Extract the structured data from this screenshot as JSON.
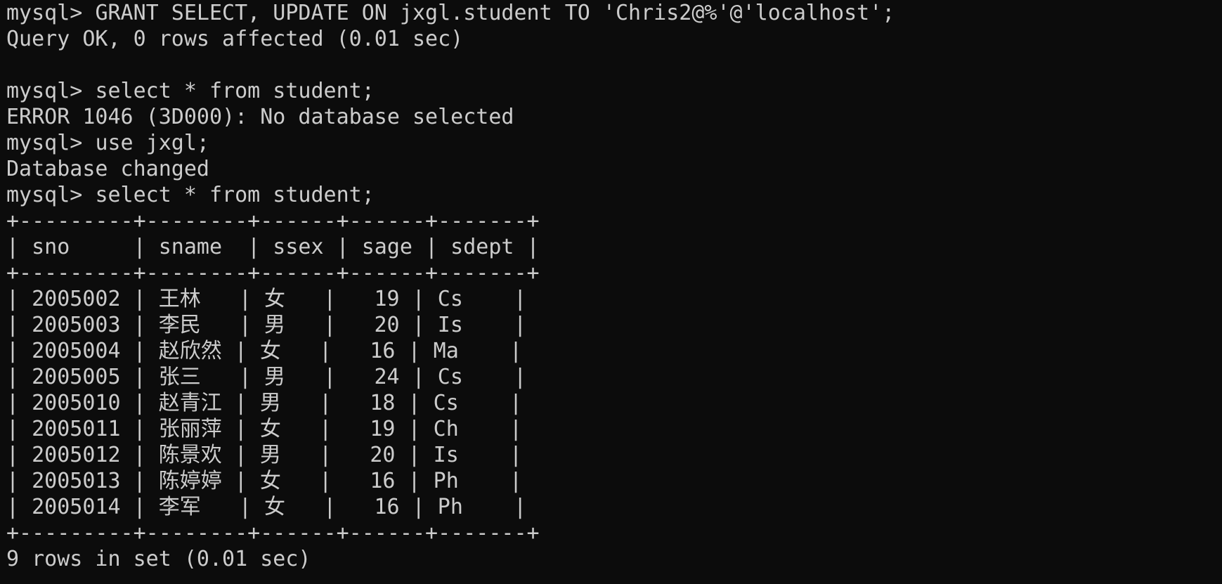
{
  "terminal": {
    "lines": [
      {
        "kind": "command",
        "prompt": "mysql>",
        "text": "GRANT SELECT, UPDATE ON jxgl.student TO 'Chris2@%'@'localhost';"
      },
      {
        "kind": "output",
        "text": "Query OK, 0 rows affected (0.01 sec)"
      },
      {
        "kind": "blank"
      },
      {
        "kind": "command",
        "prompt": "mysql>",
        "text": "select * from student;"
      },
      {
        "kind": "output",
        "text": "ERROR 1046 (3D000): No database selected"
      },
      {
        "kind": "command",
        "prompt": "mysql>",
        "text": "use jxgl;"
      },
      {
        "kind": "output",
        "text": "Database changed"
      },
      {
        "kind": "command",
        "prompt": "mysql>",
        "text": "select * from student;"
      }
    ],
    "table": {
      "border": "+---------+--------+------+------+-------+",
      "columns": [
        "sno",
        "sname",
        "ssex",
        "sage",
        "sdept"
      ],
      "header_line": "| sno     | sname  | ssex | sage | sdept |",
      "rows": [
        {
          "sno": "2005002",
          "sname": "王林",
          "ssex": "女",
          "sage": "19",
          "sdept": "Cs"
        },
        {
          "sno": "2005003",
          "sname": "李民",
          "ssex": "男",
          "sage": "20",
          "sdept": "Is"
        },
        {
          "sno": "2005004",
          "sname": "赵欣然",
          "ssex": "女",
          "sage": "16",
          "sdept": "Ma"
        },
        {
          "sno": "2005005",
          "sname": "张三",
          "ssex": "男",
          "sage": "24",
          "sdept": "Cs"
        },
        {
          "sno": "2005010",
          "sname": "赵青江",
          "ssex": "男",
          "sage": "18",
          "sdept": "Cs"
        },
        {
          "sno": "2005011",
          "sname": "张丽萍",
          "ssex": "女",
          "sage": "19",
          "sdept": "Ch"
        },
        {
          "sno": "2005012",
          "sname": "陈景欢",
          "ssex": "男",
          "sage": "20",
          "sdept": "Is"
        },
        {
          "sno": "2005013",
          "sname": "陈婷婷",
          "ssex": "女",
          "sage": "16",
          "sdept": "Ph"
        },
        {
          "sno": "2005014",
          "sname": "李军",
          "ssex": "女",
          "sage": "16",
          "sdept": "Ph"
        }
      ],
      "row_lines": [
        "| 2005002 | 王林   | 女   |   19 | Cs    |",
        "| 2005003 | 李民   | 男   |   20 | Is    |",
        "| 2005004 | 赵欣然 | 女   |   16 | Ma    |",
        "| 2005005 | 张三   | 男   |   24 | Cs    |",
        "| 2005010 | 赵青江 | 男   |   18 | Cs    |",
        "| 2005011 | 张丽萍 | 女   |   19 | Ch    |",
        "| 2005012 | 陈景欢 | 男   |   20 | Is    |",
        "| 2005013 | 陈婷婷 | 女   |   16 | Ph    |",
        "| 2005014 | 李军   | 女   |   16 | Ph    |"
      ]
    },
    "footer": "9 rows in set (0.01 sec)"
  }
}
